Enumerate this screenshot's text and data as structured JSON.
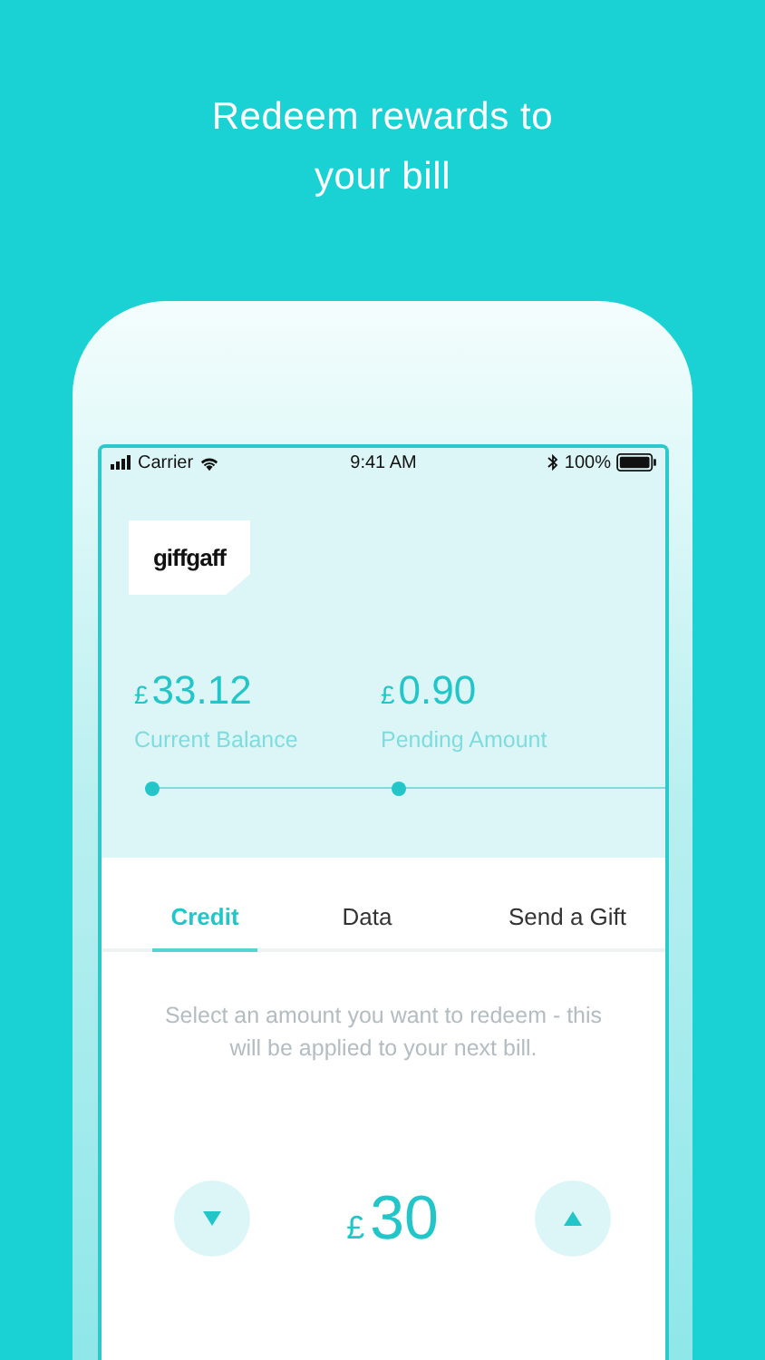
{
  "headline": "Redeem rewards to your bill",
  "status_bar": {
    "carrier": "Carrier",
    "time": "9:41 AM",
    "battery": "100%"
  },
  "logo": "giffgaff",
  "balances": [
    {
      "currency": "£",
      "amount": "33.12",
      "label": "Current Balance"
    },
    {
      "currency": "£",
      "amount": "0.90",
      "label": "Pending Amount"
    }
  ],
  "tabs": [
    {
      "label": "Credit",
      "selected": true
    },
    {
      "label": "Data",
      "selected": false
    },
    {
      "label": "Send a Gift",
      "selected": false
    }
  ],
  "description": "Select an amount you want to redeem - this will be applied to your next bill.",
  "amount": {
    "currency": "£",
    "value": "30"
  }
}
